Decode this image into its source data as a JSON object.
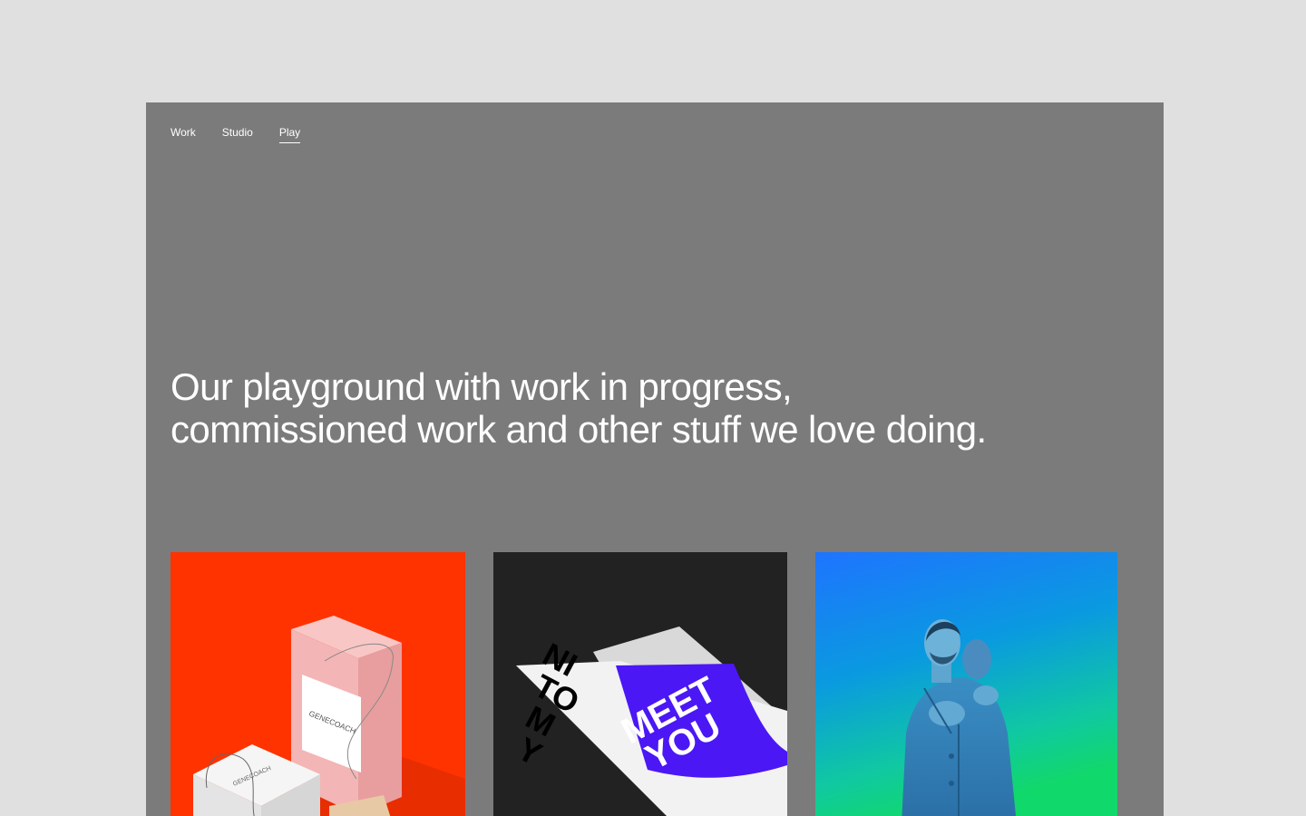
{
  "nav": {
    "items": [
      {
        "label": "Work",
        "active": false
      },
      {
        "label": "Studio",
        "active": false
      },
      {
        "label": "Play",
        "active": true
      }
    ]
  },
  "hero": {
    "line1": "Our playground with work in progress,",
    "line2": "commissioned work and other stuff we love doing."
  },
  "cards": [
    {
      "image": "gene-coach-packaging",
      "bg_color": "#ff3300",
      "brand_text": "GENECOACH"
    },
    {
      "image": "nice-to-meet-you-poster",
      "bg_color": "#222222",
      "poster_left": [
        "NI",
        "TO",
        "M",
        "Y"
      ],
      "poster_right": [
        "MEET",
        "YOU"
      ],
      "accent_color": "#4b17f5"
    },
    {
      "image": "couple-portrait-blue",
      "bg_color": "#0a8fe0"
    }
  ],
  "colors": {
    "page_bg": "#e0e0e0",
    "frame_bg": "#7b7b7b",
    "text": "#ffffff"
  }
}
